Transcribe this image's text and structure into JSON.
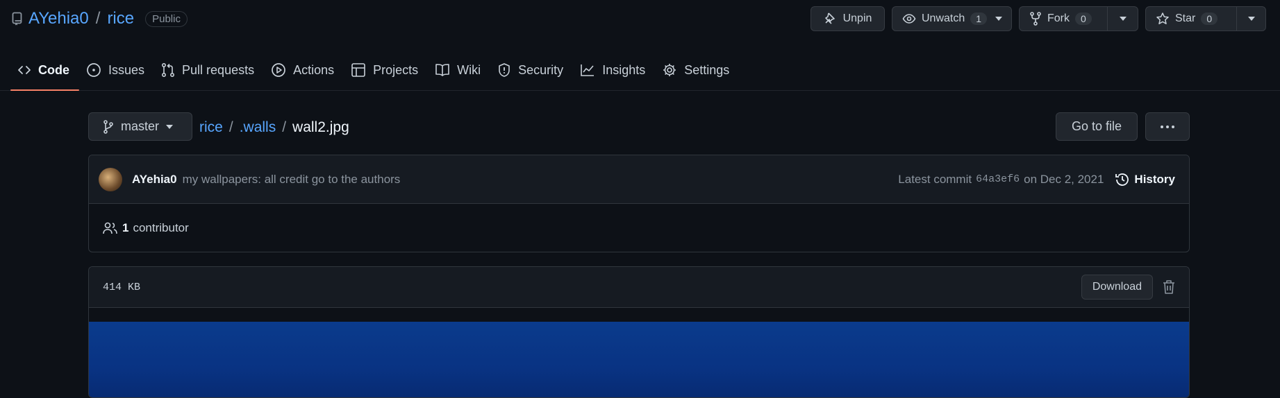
{
  "header": {
    "owner": "AYehia0",
    "separator": "/",
    "repo": "rice",
    "visibility": "Public",
    "actions": {
      "unpin": "Unpin",
      "unwatch": "Unwatch",
      "watch_count": "1",
      "fork": "Fork",
      "fork_count": "0",
      "star": "Star",
      "star_count": "0"
    }
  },
  "tabs": [
    {
      "label": "Code",
      "icon": "code-icon",
      "active": true
    },
    {
      "label": "Issues",
      "icon": "issue-icon"
    },
    {
      "label": "Pull requests",
      "icon": "pull-request-icon"
    },
    {
      "label": "Actions",
      "icon": "play-icon"
    },
    {
      "label": "Projects",
      "icon": "table-icon"
    },
    {
      "label": "Wiki",
      "icon": "book-icon"
    },
    {
      "label": "Security",
      "icon": "shield-icon"
    },
    {
      "label": "Insights",
      "icon": "graph-icon"
    },
    {
      "label": "Settings",
      "icon": "gear-icon"
    }
  ],
  "file_nav": {
    "branch": "master",
    "path": [
      {
        "label": "rice",
        "link": true
      },
      {
        "label": ".walls",
        "link": true
      },
      {
        "label": "wall2.jpg",
        "link": false
      }
    ],
    "sep": "/",
    "go_to_file": "Go to file",
    "more": "···"
  },
  "commit": {
    "author": "AYehia0",
    "message": "my wallpapers: all credit go to the authors",
    "latest_label": "Latest commit",
    "sha": "64a3ef6",
    "date": "on Dec 2, 2021",
    "history": "History",
    "contributors_count": "1",
    "contributors_label": "contributor"
  },
  "file": {
    "size": "414  KB",
    "download": "Download"
  },
  "colors": {
    "background": "#0d1117",
    "link": "#58a6ff",
    "active_tab_underline": "#f78166",
    "wallpaper_blue": "#0a3b8c"
  }
}
